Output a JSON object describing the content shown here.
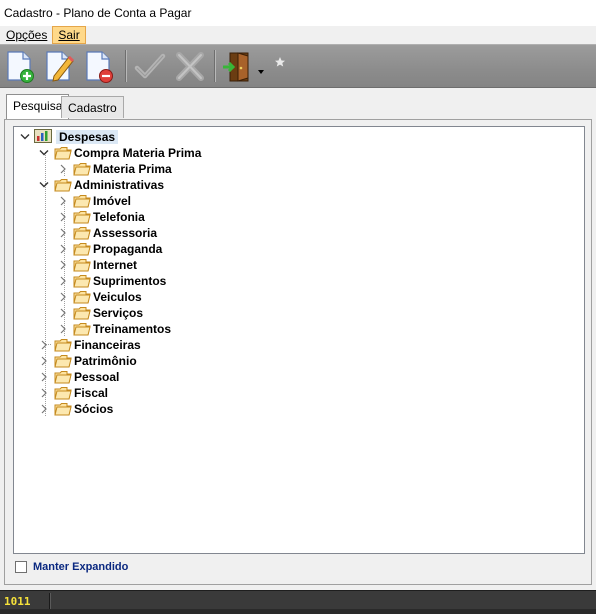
{
  "window": {
    "title": "Cadastro - Plano de Conta a Pagar"
  },
  "menu": {
    "items": [
      "Opções",
      "Sair"
    ]
  },
  "toolbar": {
    "buttons": [
      "new-document-icon",
      "edit-document-icon",
      "delete-document-icon",
      "confirm-check-icon",
      "cancel-x-icon",
      "exit-door-icon",
      "dropdown-arrow-icon",
      "star-icon"
    ]
  },
  "tabs": [
    "Pesquisa",
    "Cadastro"
  ],
  "tree": {
    "root": "Despesas",
    "compra": "Compra Materia Prima",
    "compra_child": "Materia Prima",
    "admin": "Administrativas",
    "admin_children": [
      "Imóvel",
      "Telefonia",
      "Assessoria",
      "Propaganda",
      "Internet",
      "Suprimentos",
      "Veiculos",
      "Serviços",
      "Treinamentos"
    ],
    "others": [
      "Financeiras",
      "Patrimônio",
      "Pessoal",
      "Fiscal",
      "Sócios"
    ]
  },
  "footer": {
    "checkbox_label": "Manter Expandido"
  },
  "status": {
    "code": "1011"
  }
}
